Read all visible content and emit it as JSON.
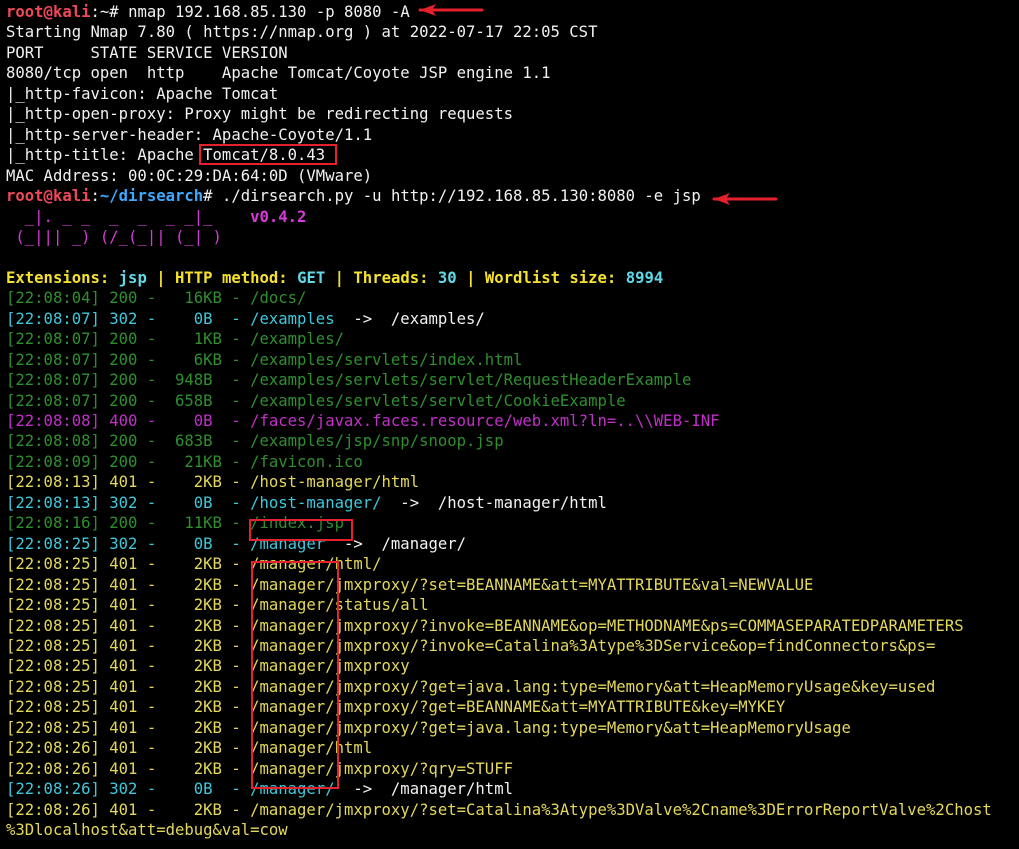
{
  "colors": {
    "background": "#000000",
    "fg": "#f2f2f2",
    "prompt_user": "#f0485a",
    "prompt_path": "#3ea8ff",
    "banner": "#d73ad8",
    "label": "#f5e12e",
    "value": "#5fd9e8",
    "status_200": "#2f8f2f",
    "status_30x": "#3fc8dc",
    "status_400": "#c32fc9",
    "status_401": "#e4d85a",
    "annotation": "#e5212c"
  },
  "lines": [
    {
      "segs": [
        {
          "t": "root@kali",
          "c": "prompt_user",
          "b": 1
        },
        {
          "t": ":~# ",
          "c": "fg"
        },
        {
          "t": "nmap 192.168.85.130 -p 8080 -A",
          "c": "fg"
        }
      ]
    },
    {
      "segs": [
        {
          "t": "Starting Nmap 7.80 ( https://nmap.org ) at 2022-07-17 22:05 CST",
          "c": "fg"
        }
      ]
    },
    {
      "segs": [
        {
          "t": "PORT     STATE SERVICE VERSION",
          "c": "fg"
        }
      ]
    },
    {
      "segs": [
        {
          "t": "8080/tcp open  http    Apache Tomcat/Coyote JSP engine 1.1",
          "c": "fg"
        }
      ]
    },
    {
      "segs": [
        {
          "t": "|_http-favicon: Apache Tomcat",
          "c": "fg"
        }
      ]
    },
    {
      "segs": [
        {
          "t": "|_http-open-proxy: Proxy might be redirecting requests",
          "c": "fg"
        }
      ]
    },
    {
      "segs": [
        {
          "t": "|_http-server-header: Apache-Coyote/1.1",
          "c": "fg"
        }
      ]
    },
    {
      "segs": [
        {
          "t": "|_http-title: Apache Tomcat/8.0.43",
          "c": "fg"
        }
      ]
    },
    {
      "segs": [
        {
          "t": "MAC Address: 00:0C:29:DA:64:0D (VMware)",
          "c": "fg"
        }
      ]
    },
    {
      "segs": [
        {
          "t": "root@kali",
          "c": "prompt_user",
          "b": 1
        },
        {
          "t": ":",
          "c": "fg"
        },
        {
          "t": "~/dirsearch",
          "c": "prompt_path",
          "b": 1
        },
        {
          "t": "# ",
          "c": "fg"
        },
        {
          "t": "./dirsearch.py -u http://192.168.85.130:8080 -e jsp",
          "c": "fg"
        }
      ]
    },
    {
      "segs": [
        {
          "t": "  _|. _ _  _  _  _ _|_    ",
          "c": "banner"
        },
        {
          "t": "v0.4.2",
          "c": "banner",
          "b": 1
        }
      ]
    },
    {
      "segs": [
        {
          "t": " (_||| _) (/_(_|| (_| )",
          "c": "banner"
        }
      ]
    },
    {
      "segs": []
    },
    {
      "segs": [
        {
          "t": "Extensions: ",
          "c": "label",
          "b": 1
        },
        {
          "t": "jsp",
          "c": "value",
          "b": 1
        },
        {
          "t": " | ",
          "c": "label",
          "b": 1
        },
        {
          "t": "HTTP method: ",
          "c": "label",
          "b": 1
        },
        {
          "t": "GET",
          "c": "value",
          "b": 1
        },
        {
          "t": " | ",
          "c": "label",
          "b": 1
        },
        {
          "t": "Threads: ",
          "c": "label",
          "b": 1
        },
        {
          "t": "30",
          "c": "value",
          "b": 1
        },
        {
          "t": " | ",
          "c": "label",
          "b": 1
        },
        {
          "t": "Wordlist size: ",
          "c": "label",
          "b": 1
        },
        {
          "t": "8994",
          "c": "value",
          "b": 1
        }
      ]
    },
    {
      "segs": [
        {
          "t": "[22:08:04] 200 -   16KB - /docs/",
          "c": "status_200"
        }
      ]
    },
    {
      "segs": [
        {
          "t": "[22:08:07] 302 -    0B  - /examples",
          "c": "status_30x"
        },
        {
          "t": "  ->  /examples/",
          "c": "fg"
        }
      ]
    },
    {
      "segs": [
        {
          "t": "[22:08:07] 200 -    1KB - /examples/",
          "c": "status_200"
        }
      ]
    },
    {
      "segs": [
        {
          "t": "[22:08:07] 200 -    6KB - /examples/servlets/index.html",
          "c": "status_200"
        }
      ]
    },
    {
      "segs": [
        {
          "t": "[22:08:07] 200 -  948B  - /examples/servlets/servlet/RequestHeaderExample",
          "c": "status_200"
        }
      ]
    },
    {
      "segs": [
        {
          "t": "[22:08:07] 200 -  658B  - /examples/servlets/servlet/CookieExample",
          "c": "status_200"
        }
      ]
    },
    {
      "segs": [
        {
          "t": "[22:08:08] 400 -    0B  - /faces/javax.faces.resource/web.xml?ln=..\\\\WEB-INF",
          "c": "status_400"
        }
      ]
    },
    {
      "segs": [
        {
          "t": "[22:08:08] 200 -  683B  - /examples/jsp/snp/snoop.jsp",
          "c": "status_200"
        }
      ]
    },
    {
      "segs": [
        {
          "t": "[22:08:09] 200 -   21KB - /favicon.ico",
          "c": "status_200"
        }
      ]
    },
    {
      "segs": [
        {
          "t": "[22:08:13] 401 -    2KB - /host-manager/html",
          "c": "status_401"
        }
      ]
    },
    {
      "segs": [
        {
          "t": "[22:08:13] 302 -    0B  - /host-manager/",
          "c": "status_30x"
        },
        {
          "t": "  ->  /host-manager/html",
          "c": "fg"
        }
      ]
    },
    {
      "segs": [
        {
          "t": "[22:08:16] 200 -   11KB - /index.jsp",
          "c": "status_200"
        }
      ]
    },
    {
      "segs": [
        {
          "t": "[22:08:25] 302 -    0B  - /manager",
          "c": "status_30x"
        },
        {
          "t": "  ->  /manager/",
          "c": "fg"
        }
      ]
    },
    {
      "segs": [
        {
          "t": "[22:08:25] 401 -    2KB - /manager/html/",
          "c": "status_401"
        }
      ]
    },
    {
      "segs": [
        {
          "t": "[22:08:25] 401 -    2KB - /manager/jmxproxy/?set=BEANNAME&att=MYATTRIBUTE&val=NEWVALUE",
          "c": "status_401"
        }
      ]
    },
    {
      "segs": [
        {
          "t": "[22:08:25] 401 -    2KB - /manager/status/all",
          "c": "status_401"
        }
      ]
    },
    {
      "segs": [
        {
          "t": "[22:08:25] 401 -    2KB - /manager/jmxproxy/?invoke=BEANNAME&op=METHODNAME&ps=COMMASEPARATEDPARAMETERS",
          "c": "status_401"
        }
      ]
    },
    {
      "segs": [
        {
          "t": "[22:08:25] 401 -    2KB - /manager/jmxproxy/?invoke=Catalina%3Atype%3DService&op=findConnectors&ps=",
          "c": "status_401"
        }
      ]
    },
    {
      "segs": [
        {
          "t": "[22:08:25] 401 -    2KB - /manager/jmxproxy",
          "c": "status_401"
        }
      ]
    },
    {
      "segs": [
        {
          "t": "[22:08:25] 401 -    2KB - /manager/jmxproxy/?get=java.lang:type=Memory&att=HeapMemoryUsage&key=used",
          "c": "status_401"
        }
      ]
    },
    {
      "segs": [
        {
          "t": "[22:08:25] 401 -    2KB - /manager/jmxproxy/?get=BEANNAME&att=MYATTRIBUTE&key=MYKEY",
          "c": "status_401"
        }
      ]
    },
    {
      "segs": [
        {
          "t": "[22:08:25] 401 -    2KB - /manager/jmxproxy/?get=java.lang:type=Memory&att=HeapMemoryUsage",
          "c": "status_401"
        }
      ]
    },
    {
      "segs": [
        {
          "t": "[22:08:26] 401 -    2KB - /manager/html",
          "c": "status_401"
        }
      ]
    },
    {
      "segs": [
        {
          "t": "[22:08:26] 401 -    2KB - /manager/jmxproxy/?qry=STUFF",
          "c": "status_401"
        }
      ]
    },
    {
      "segs": [
        {
          "t": "[22:08:26] 302 -    0B  - /manager/",
          "c": "status_30x"
        },
        {
          "t": "  ->  /manager/html",
          "c": "fg"
        }
      ]
    },
    {
      "segs": [
        {
          "t": "[22:08:26] 401 -    2KB - /manager/jmxproxy/?set=Catalina%3Atype%3DValve%2Cname%3DErrorReportValve%2Chost",
          "c": "status_401"
        }
      ]
    },
    {
      "segs": [
        {
          "t": "%3Dlocalhost&att=debug&val=cow",
          "c": "status_401"
        }
      ]
    }
  ]
}
